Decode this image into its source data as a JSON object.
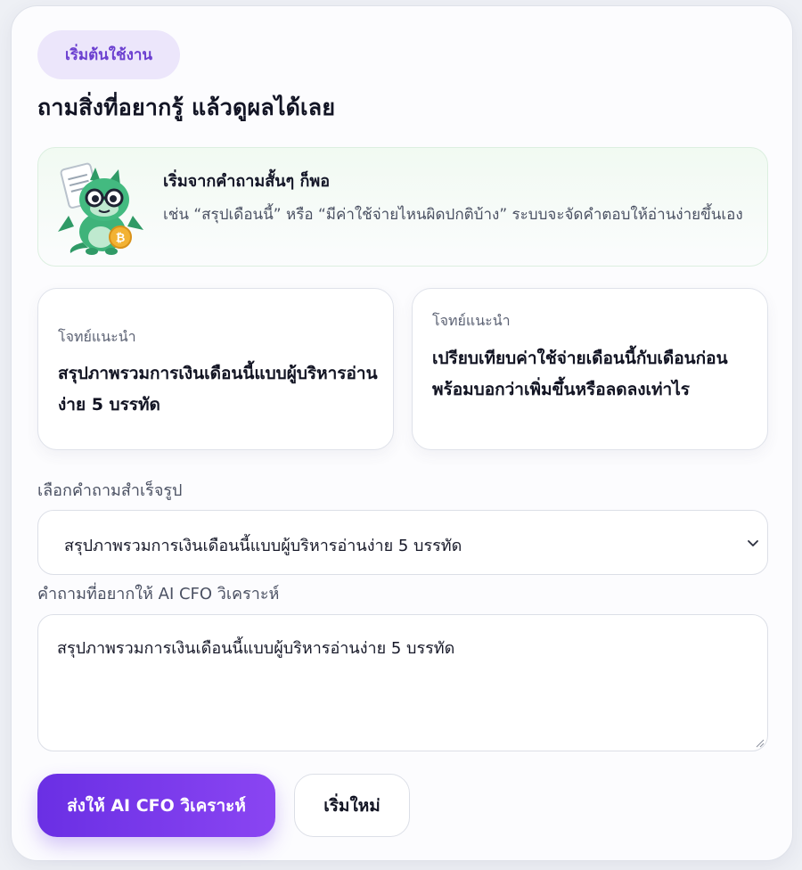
{
  "badge": "เริ่มต้นใช้งาน",
  "title": "ถามสิ่งที่อยากรู้ แล้วดูผลได้เลย",
  "tip": {
    "title": "เริ่มจากคำถามสั้นๆ ก็พอ",
    "body": "เช่น “สรุปเดือนนี้” หรือ “มีค่าใช้จ่ายไหนผิดปกติบ้าง” ระบบจะจัดคำตอบให้อ่านง่ายขึ้นเอง",
    "mascot_icon": "dragon-mascot-icon"
  },
  "prompts": [
    {
      "tag": "โจทย์แนะนำ",
      "text": "สรุปภาพรวมการเงินเดือนนี้แบบผู้บริหารอ่านง่าย 5 บรรทัด"
    },
    {
      "tag": "โจทย์แนะนำ",
      "text": "เปรียบเทียบค่าใช้จ่ายเดือนนี้กับเดือนก่อน พร้อมบอกว่าเพิ่มขึ้นหรือลดลงเท่าไร"
    }
  ],
  "preset": {
    "label": "เลือกคำถามสำเร็จรูป",
    "selected": "สรุปภาพรวมการเงินเดือนนี้แบบผู้บริหารอ่านง่าย 5 บรรทัด"
  },
  "question": {
    "label": "คำถามที่อยากให้ AI CFO วิเคราะห์",
    "value": "สรุปภาพรวมการเงินเดือนนี้แบบผู้บริหารอ่านง่าย 5 บรรทัด"
  },
  "actions": {
    "submit": "ส่งให้ AI CFO วิเคราะห์",
    "reset": "เริ่มใหม่"
  },
  "colors": {
    "accent": "#6a2fe4",
    "badge_bg": "#ece6fb",
    "tip_bg": "#f1faf2",
    "mascot_green": "#3fb37a",
    "coin": "#f2b233"
  }
}
